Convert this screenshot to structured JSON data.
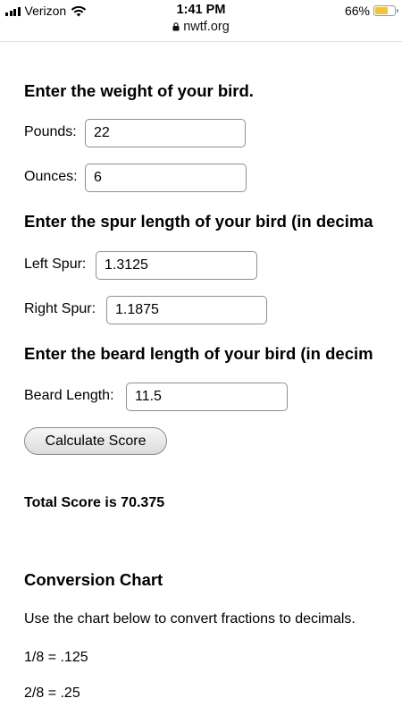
{
  "status_bar": {
    "carrier": "Verizon",
    "time": "1:41 PM",
    "battery_percent": "66%",
    "battery_level": 0.66,
    "battery_color": "#f4c430"
  },
  "browser": {
    "url": "nwtf.org"
  },
  "form": {
    "weight_heading": "Enter the weight of your bird.",
    "pounds_label": "Pounds:",
    "pounds_value": "22",
    "ounces_label": "Ounces:",
    "ounces_value": "6",
    "spur_heading": "Enter the spur length of your bird (in decima",
    "left_spur_label": "Left Spur:",
    "left_spur_value": "1.3125",
    "right_spur_label": "Right Spur:",
    "right_spur_value": "1.1875",
    "beard_heading": "Enter the beard length of your bird (in decim",
    "beard_label": "Beard Length:",
    "beard_value": "11.5",
    "calculate_label": "Calculate Score"
  },
  "result": {
    "total_score_text": "Total Score is 70.375"
  },
  "conversion": {
    "heading": "Conversion Chart",
    "intro": "Use the chart below to convert fractions to decimals.",
    "rows": [
      "1/8 = .125",
      "2/8 = .25"
    ]
  }
}
